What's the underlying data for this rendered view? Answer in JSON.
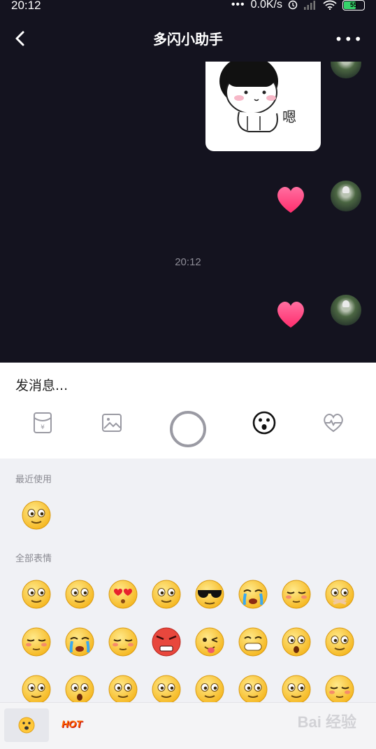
{
  "status_bar": {
    "time": "20:12",
    "dots": "•••",
    "speed": "0.0K/s",
    "battery": "55"
  },
  "header": {
    "title": "多闪小助手",
    "more": "•••"
  },
  "chat": {
    "timestamp": "20:12",
    "sticker_text": "嗯"
  },
  "composer": {
    "placeholder": "发消息..."
  },
  "emoji_panel": {
    "recent_label": "最近使用",
    "all_label": "全部表情",
    "recent": [
      "smile"
    ],
    "all": [
      "smile",
      "annoyed",
      "heart-eyes-kiss",
      "teary",
      "cool-sunglasses",
      "crying",
      "shy-blush",
      "mouth-covered",
      "sleepy",
      "wailing",
      "smirk",
      "angry-red",
      "tongue-wink",
      "grin-teeth",
      "shocked",
      "frown",
      "worried",
      "scream",
      "freezing",
      "thinking",
      "happy",
      "eye-roll",
      "suspicious",
      "unamused"
    ]
  },
  "tabs": {
    "emoji": "emoji-tab",
    "hot": "HOT",
    "watermark": "Bai 经验"
  }
}
